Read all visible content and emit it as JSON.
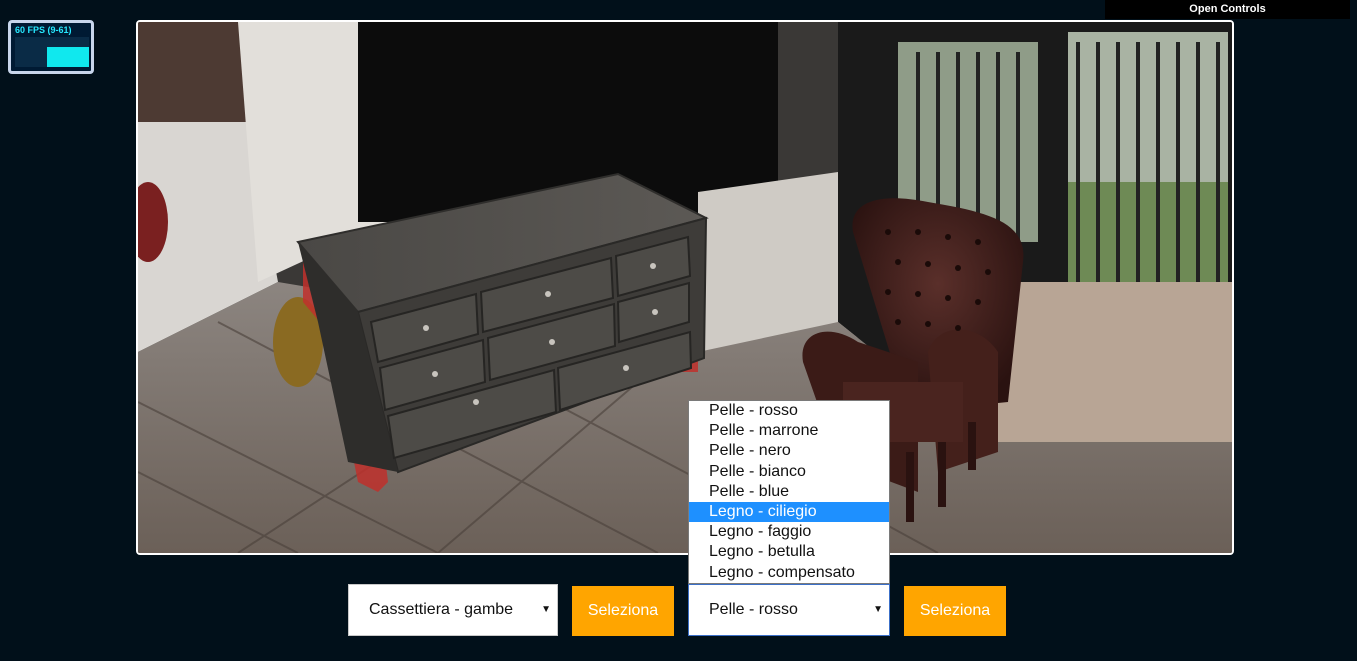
{
  "stats": {
    "fps_label": "60 FPS (9-61)"
  },
  "controls": {
    "open_label": "Open Controls"
  },
  "object_select": {
    "value": "Cassettiera - gambe"
  },
  "object_button": {
    "label": "Seleziona"
  },
  "material_select": {
    "value": "Pelle - rosso"
  },
  "material_button": {
    "label": "Seleziona"
  },
  "material_options": [
    "Pelle - rosso",
    "Pelle - marrone",
    "Pelle - nero",
    "Pelle - bianco",
    "Pelle - blue",
    "Legno - ciliegio",
    "Legno - faggio",
    "Legno - betulla",
    "Legno - compensato"
  ],
  "highlighted_option": "Legno - ciliegio",
  "colors": {
    "page_bg": "#01101a",
    "accent": "#ffa500",
    "highlight": "#1e90ff",
    "stats_text": "#26e8ff"
  }
}
